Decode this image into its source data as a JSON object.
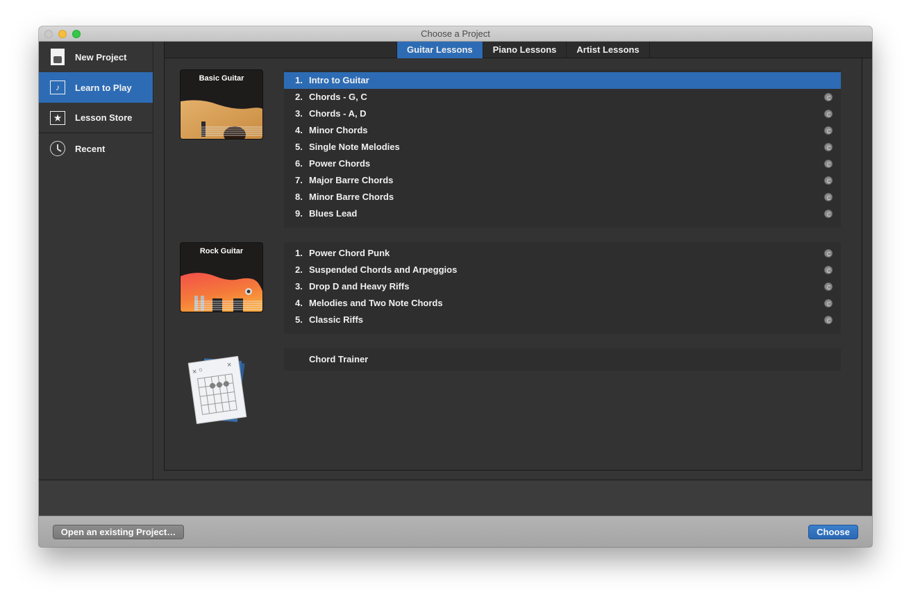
{
  "window": {
    "title": "Choose a Project"
  },
  "sidebar": {
    "items": [
      {
        "label": "New Project",
        "icon": "new-project-icon",
        "active": false
      },
      {
        "label": "Learn to Play",
        "icon": "music-note-screen-icon",
        "active": true
      },
      {
        "label": "Lesson Store",
        "icon": "star-screen-icon",
        "active": false
      },
      {
        "label": "Recent",
        "icon": "clock-icon",
        "active": false
      }
    ]
  },
  "tabs": [
    {
      "label": "Guitar Lessons",
      "active": true
    },
    {
      "label": "Piano Lessons",
      "active": false
    },
    {
      "label": "Artist Lessons",
      "active": false
    }
  ],
  "groups": [
    {
      "thumb_title": "Basic Guitar",
      "lessons": [
        {
          "num": "1.",
          "title": "Intro to Guitar",
          "selected": true,
          "download": false
        },
        {
          "num": "2.",
          "title": "Chords - G, C",
          "selected": false,
          "download": true
        },
        {
          "num": "3.",
          "title": "Chords - A, D",
          "selected": false,
          "download": true
        },
        {
          "num": "4.",
          "title": "Minor Chords",
          "selected": false,
          "download": true
        },
        {
          "num": "5.",
          "title": "Single Note Melodies",
          "selected": false,
          "download": true
        },
        {
          "num": "6.",
          "title": "Power Chords",
          "selected": false,
          "download": true
        },
        {
          "num": "7.",
          "title": "Major Barre Chords",
          "selected": false,
          "download": true
        },
        {
          "num": "8.",
          "title": "Minor Barre Chords",
          "selected": false,
          "download": true
        },
        {
          "num": "9.",
          "title": "Blues Lead",
          "selected": false,
          "download": true
        }
      ]
    },
    {
      "thumb_title": "Rock Guitar",
      "lessons": [
        {
          "num": "1.",
          "title": "Power Chord Punk",
          "selected": false,
          "download": true
        },
        {
          "num": "2.",
          "title": "Suspended Chords and Arpeggios",
          "selected": false,
          "download": true
        },
        {
          "num": "3.",
          "title": "Drop D and Heavy Riffs",
          "selected": false,
          "download": true
        },
        {
          "num": "4.",
          "title": "Melodies and Two Note Chords",
          "selected": false,
          "download": true
        },
        {
          "num": "5.",
          "title": "Classic Riffs",
          "selected": false,
          "download": true
        }
      ]
    }
  ],
  "chord_trainer": {
    "title": "Chord Trainer",
    "chart_marks": [
      "×",
      "○",
      "×"
    ]
  },
  "footer": {
    "open_label": "Open an existing Project…",
    "choose_label": "Choose"
  },
  "colors": {
    "accent": "#2d6cb5",
    "background": "#353535",
    "list_bg": "#2e2e2e"
  }
}
